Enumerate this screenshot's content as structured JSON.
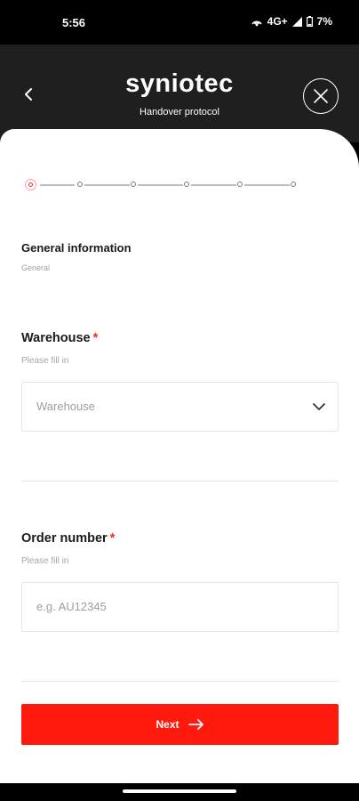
{
  "status_bar": {
    "time": "5:56",
    "network": "4G+",
    "battery": "7%"
  },
  "header": {
    "brand": "syniotec",
    "subtitle": "Handover protocol"
  },
  "stepper": {
    "total_steps": 6,
    "current_step": 1
  },
  "section": {
    "title": "General information",
    "subtitle": "General"
  },
  "fields": [
    {
      "label": "Warehouse",
      "required_mark": "*",
      "hint": "Please fill in",
      "placeholder": "Warehouse"
    },
    {
      "label": "Order number",
      "required_mark": "*",
      "hint": "Please fill in",
      "placeholder": "e.g. AU12345"
    }
  ],
  "actions": {
    "next_label": "Next"
  },
  "colors": {
    "accent": "#ff1a0d",
    "header_bg": "#1f1f1f"
  }
}
